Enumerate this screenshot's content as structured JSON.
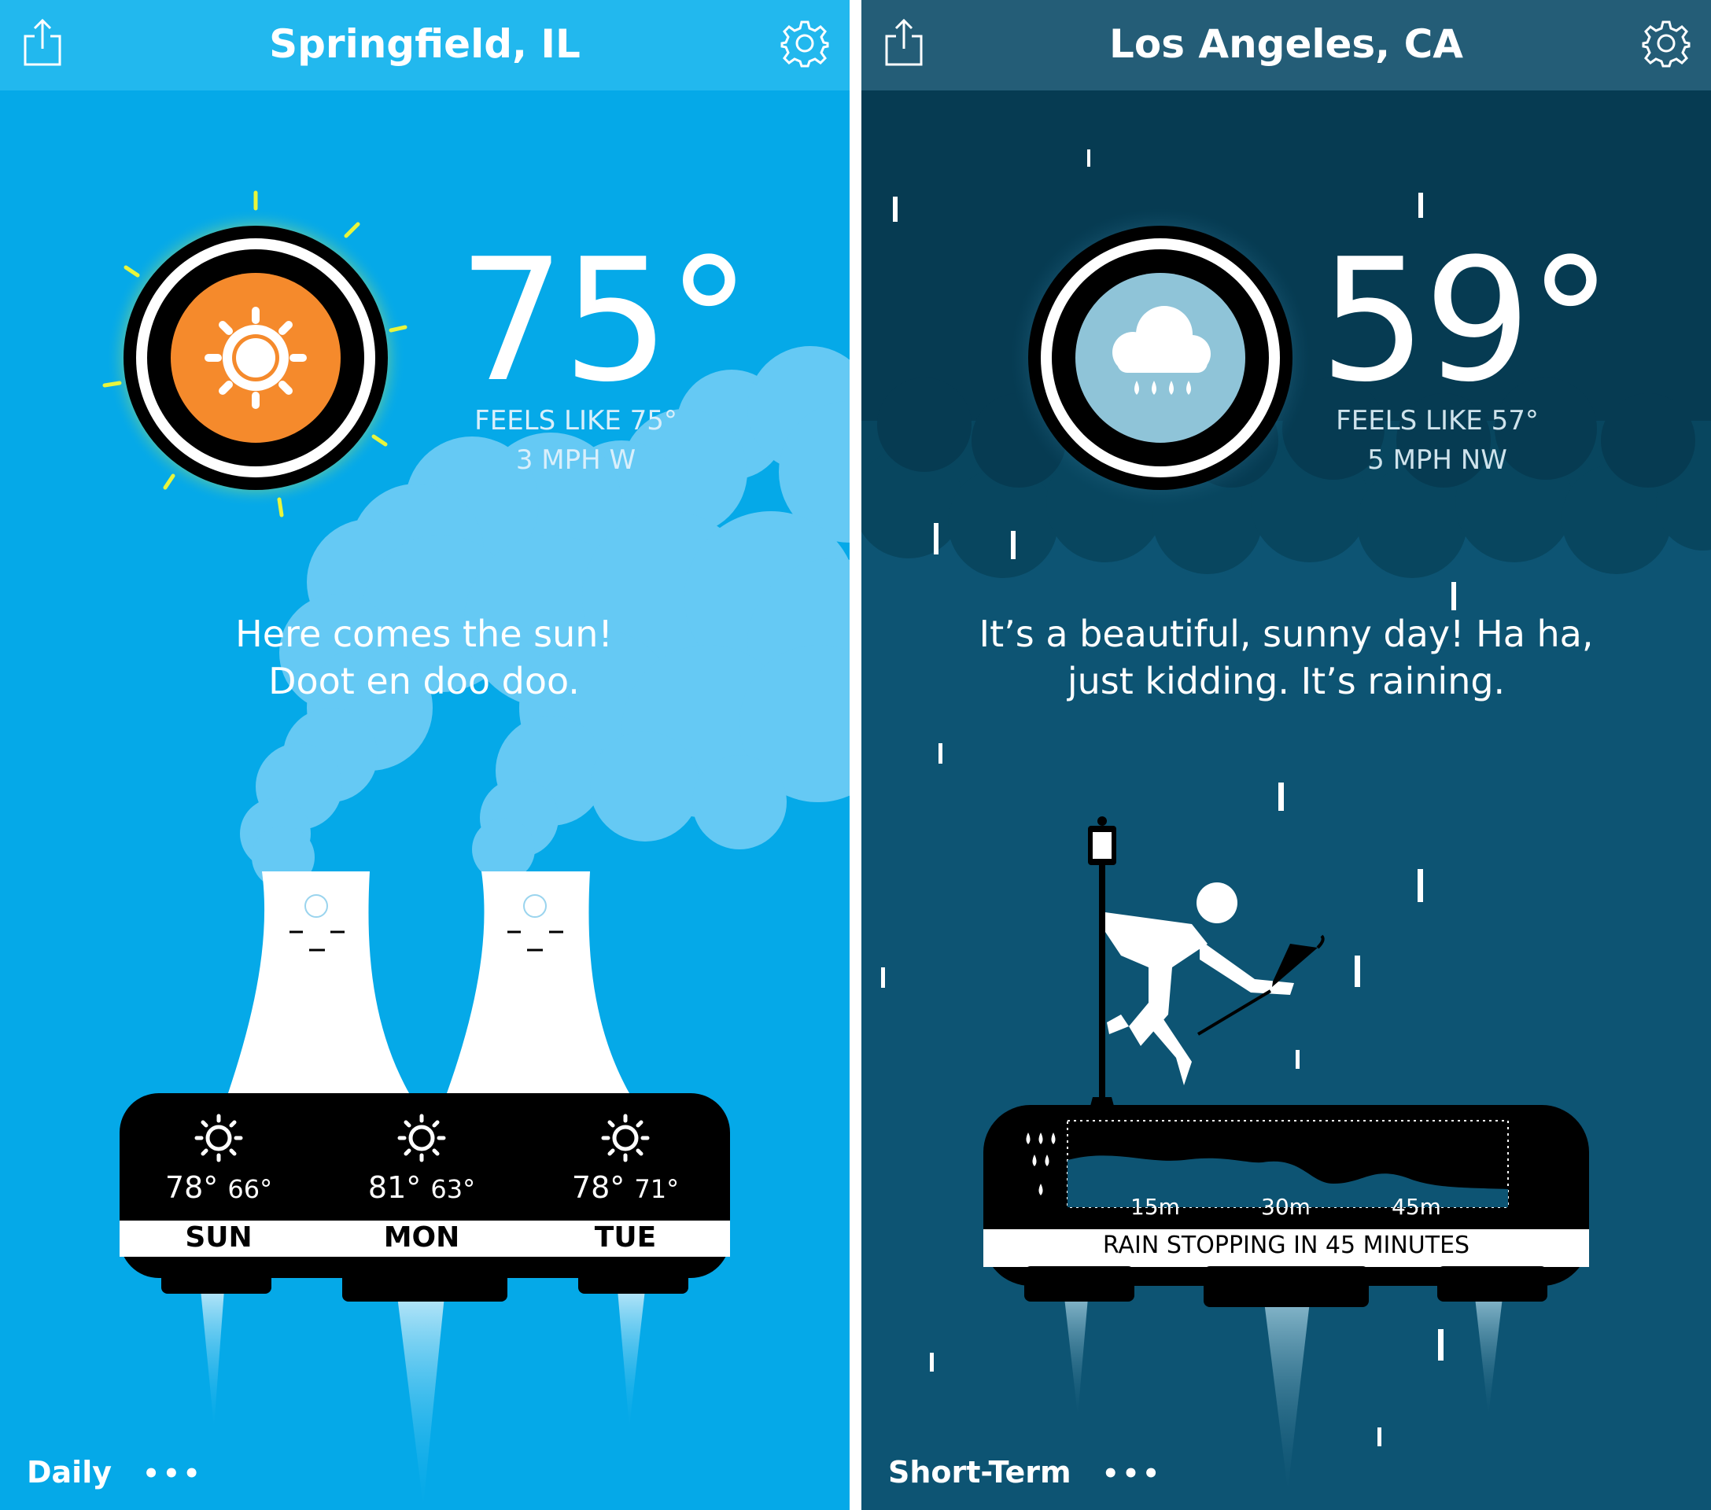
{
  "left_screen": {
    "colors": {
      "background": "#05a9e8",
      "header": "#22b8ee",
      "sun_core": "#f58a2c",
      "glow": "#e6f23c"
    },
    "header": {
      "title": "Springfield, IL",
      "share_icon": "share-icon",
      "settings_icon": "gear-icon"
    },
    "current": {
      "condition_icon": "sun-icon",
      "temperature": "75°",
      "feels_like": "FEELS LIKE 75°",
      "wind": "3 MPH W"
    },
    "message": {
      "line1": "Here comes the sun!",
      "line2": "Doot en doo doo."
    },
    "forecast": [
      {
        "icon": "sun-icon",
        "high": "78°",
        "low": "66°",
        "day": "SUN"
      },
      {
        "icon": "sun-icon",
        "high": "81°",
        "low": "63°",
        "day": "MON"
      },
      {
        "icon": "sun-icon",
        "high": "78°",
        "low": "71°",
        "day": "TUE"
      }
    ],
    "bottom_tab": {
      "label": "Daily",
      "more": "•••"
    }
  },
  "right_screen": {
    "colors": {
      "background": "#0d5473",
      "header": "#245d77",
      "icon_core": "#8fc4d8"
    },
    "header": {
      "title": "Los Angeles, CA",
      "share_icon": "share-icon",
      "settings_icon": "gear-icon"
    },
    "current": {
      "condition_icon": "rain-cloud-icon",
      "temperature": "59°",
      "feels_like": "FEELS LIKE 57°",
      "wind": "5 MPH NW"
    },
    "message": {
      "line1": "It’s a beautiful, sunny day! Ha ha,",
      "line2": "just kidding. It’s raining."
    },
    "precip_chart": {
      "ticks": [
        "15m",
        "30m",
        "45m"
      ],
      "banner": "RAIN STOPPING IN 45 MINUTES"
    },
    "bottom_tab": {
      "label": "Short-Term",
      "more": "•••"
    }
  }
}
